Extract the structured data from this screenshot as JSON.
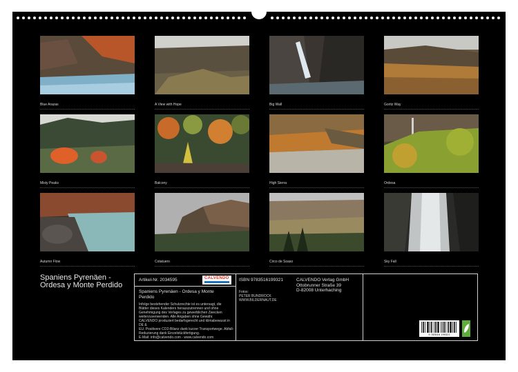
{
  "photos": [
    {
      "caption": "Blue Arazas",
      "scene": "river"
    },
    {
      "caption": "A View with Hope",
      "scene": "valley"
    },
    {
      "caption": "Big Wall",
      "scene": "waterfall"
    },
    {
      "caption": "Goritz Way",
      "scene": "plateau"
    },
    {
      "caption": "Misty Peaks",
      "scene": "forest"
    },
    {
      "caption": "Balcony",
      "scene": "autumn"
    },
    {
      "caption": "High Sierra",
      "scene": "sierra"
    },
    {
      "caption": "Ordesa",
      "scene": "cliffforest"
    },
    {
      "caption": "Autumn Flow",
      "scene": "stream"
    },
    {
      "caption": "Cotatuero",
      "scene": "cliff"
    },
    {
      "caption": "Circo de Soaso",
      "scene": "canyon"
    },
    {
      "caption": "Sky Fall",
      "scene": "bigfall"
    }
  ],
  "calendar_title": "Spaniens Pyrenäen - Ordesa y Monte Perdido",
  "info": {
    "article": "Artikel-Nr. 2034595",
    "logo": "CALVENDO",
    "subtitle": "Spaniens Pyrenäen - Ordesa y Monte Perdido",
    "legal_lines": [
      "Infolge bestehender Schutzrechte ist es untersagt, die",
      "Blätter dieses Kalenders herauszutrennen und ohne",
      "Genehmigung des Verlages zu gewerblichen Zwecken",
      "weiterzuverwenden. Alle Angaben ohne Gewähr.",
      "CALVENDO produziert bedarfsgerecht und klimabewusst in DE &",
      "EU. Positivere CO2-Bilanz dank kurzer Transportwege. Abfall-",
      "Reduzierung dank Einzelstückfertigung.",
      "E-Mail: info@calvendo.com - www.calvendo.com"
    ],
    "isbn": "ISBN 9783516199321",
    "photo_credit_lines": [
      "Fotos:",
      "PETER BUNDROCK",
      "WWW.BILDERNAUT.DE"
    ],
    "publisher_lines": [
      "CALVENDO Verlag GmbH",
      "Ottobrunner Straße 39",
      "D-82008 Unterhaching"
    ],
    "barcode_digits": "9 783516 199321"
  }
}
